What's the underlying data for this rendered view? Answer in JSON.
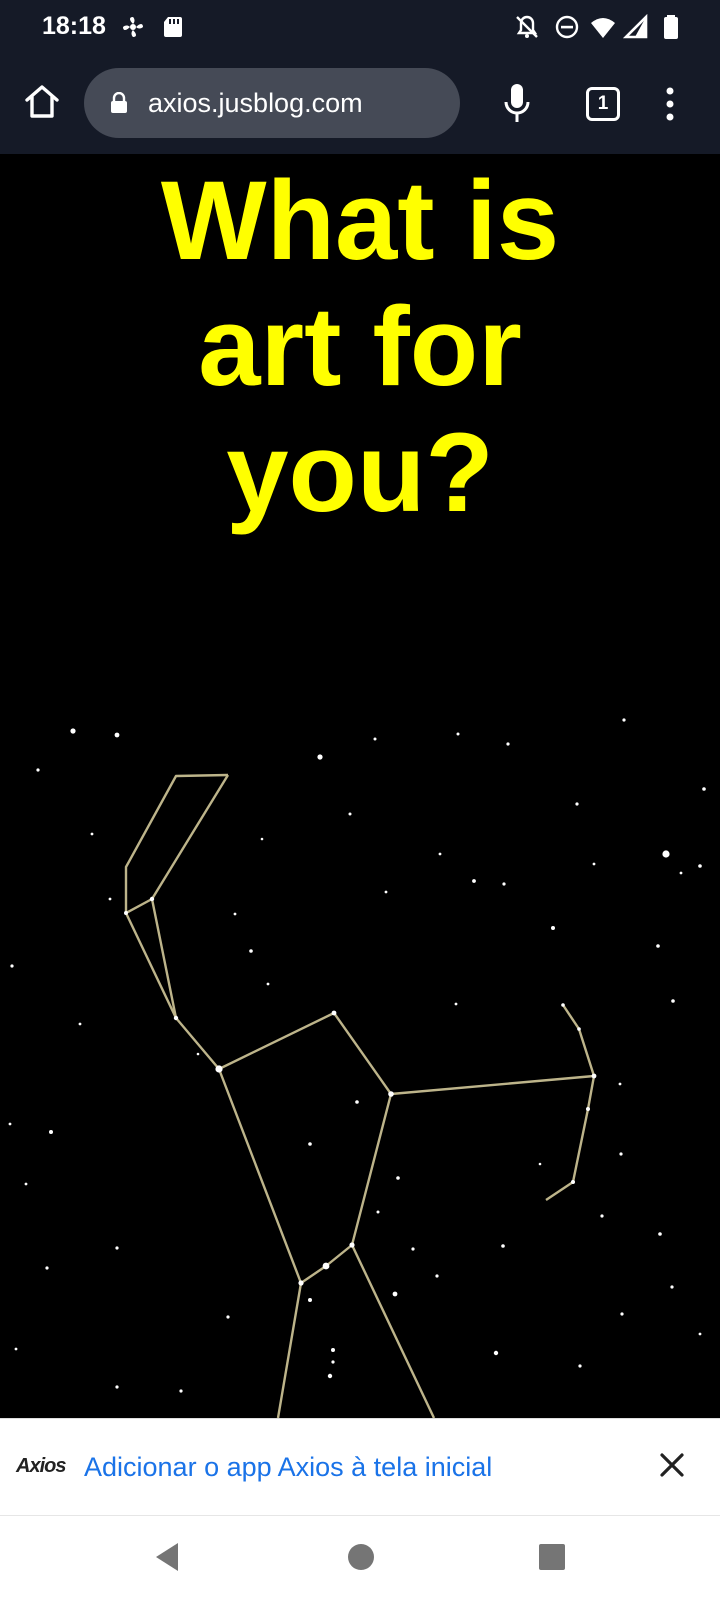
{
  "status_bar": {
    "time": "18:18",
    "left_icons": [
      "fan-icon",
      "sd-card-icon"
    ],
    "right_icons": [
      "notifications-off-icon",
      "do-not-disturb-icon",
      "wifi-icon",
      "signal-icon",
      "battery-icon"
    ]
  },
  "browser": {
    "url": "axios.jusblog.com",
    "tab_count": "1"
  },
  "page": {
    "headline_line1": "What is",
    "headline_line2": "art for",
    "headline_line3": "you?"
  },
  "install_banner": {
    "logo_text": "Axios",
    "message": "Adicionar o app Axios à tela inicial"
  },
  "colors": {
    "headline": "#ffff00",
    "link": "#1a73e8",
    "bar_background": "#151a27",
    "constellation_line": "#bdb48a"
  }
}
